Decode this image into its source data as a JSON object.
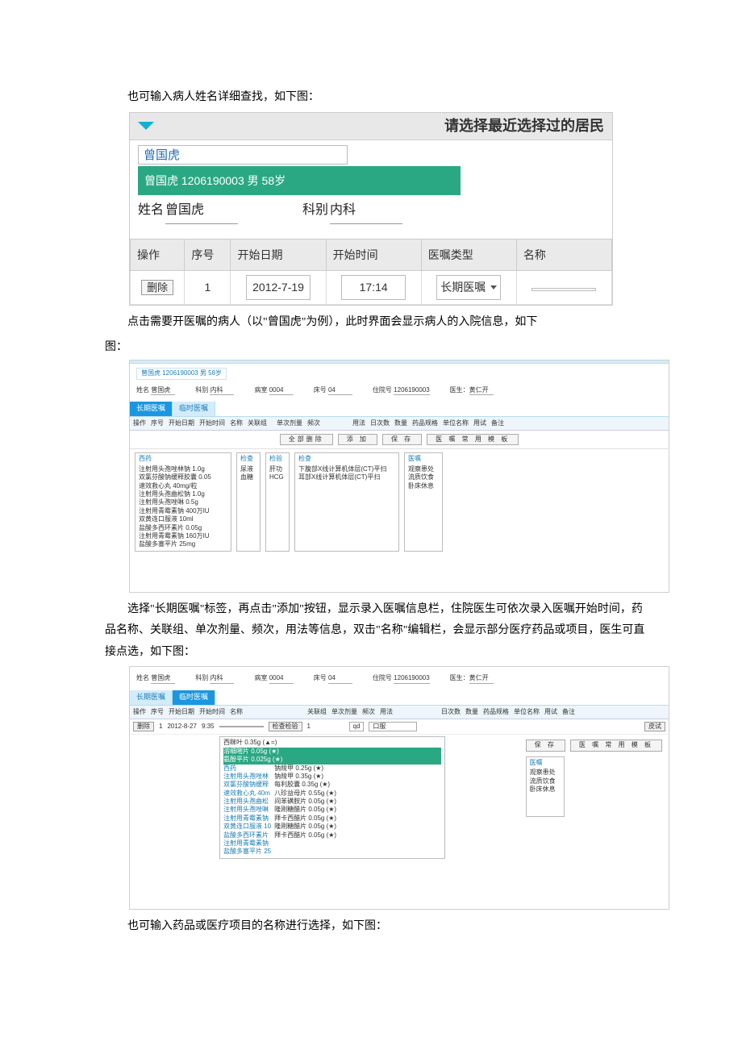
{
  "text": {
    "para1": "也可输入病人姓名详细查找，如下图：",
    "para2a": "点击需要开医嘱的病人（以\"曾国虎\"为例），此时界面会显示病人的入院信息，如下",
    "para2b": "图：",
    "para3": "选择\"长期医嘱\"标签，再点击\"添加\"按钮，显示录入医嘱信息栏，住院医生可依次录入医嘱开始时间，药品名称、关联组、单次剂量、频次，用法等信息，双击\"名称\"编辑栏，会显示部分医疗药品或项目，医生可直接点选，如下图：",
    "para4": "也可输入药品或医疗项目的名称进行选择，如下图："
  },
  "s1": {
    "caption": "请选择最近选择过的居民",
    "search_value": "曾国虎",
    "dropdown_hit": "曾国虎 1206190003 男 58岁",
    "name_label": "姓名",
    "name_value": "曾国虎",
    "dept_label": "科别",
    "dept_value": "内科",
    "columns": [
      "操作",
      "序号",
      "开始日期",
      "开始时间",
      "医嘱类型",
      "名称"
    ],
    "row": {
      "delete": "删除",
      "seq": "1",
      "date": "2012-7-19",
      "time": "17:14",
      "type": "长期医嘱",
      "name": ""
    }
  },
  "s2": {
    "patient_box": "曾国虎 1206190003 男 58岁",
    "meta": {
      "name_label": "姓名",
      "name": "曾国虎",
      "dept_label": "科别",
      "dept": "内科",
      "ward_label": "病室",
      "ward": "0004",
      "bed_label": "床号",
      "bed": "04",
      "hosp_label": "住院号",
      "hosp": "1206190003",
      "doctor_label": "医生：",
      "doctor": "黄仁开"
    },
    "tabs": [
      "长期医嘱",
      "临时医嘱"
    ],
    "columns": [
      "操作",
      "序号",
      "开始日期",
      "开始时间",
      "名称",
      "关联组",
      "单次剂量",
      "频次",
      "用法",
      "日次数",
      "数量",
      "药品规格",
      "单位名称",
      "用试",
      "备注"
    ],
    "buttons": {
      "delete_all": "全部删除",
      "add": "添 加",
      "save": "保 存",
      "template": "医 嘱 常 用 模 板"
    },
    "panels": {
      "drugs": {
        "title": "西药",
        "items": [
          "注射用头孢唑林钠 1.0g",
          "双氯芬酸钠缓释胶囊 0.05",
          "速效救心丸 40mg/粒",
          "注射用头孢曲松钠 1.0g",
          "注射用头孢唑啉 0.5g",
          "注射用青霉素钠 400万IU",
          "双黄连口服液 10ml",
          "盐酸多西环素片 0.05g",
          "注射用青霉素钠 160万IU",
          "盐酸多塞平片 25mg"
        ]
      },
      "test1": {
        "title": "检查",
        "items": [
          "尿液",
          "血糖"
        ]
      },
      "test2": {
        "title": "检验",
        "items": [
          "肝功",
          "HCG"
        ]
      },
      "exam": {
        "title": "检查",
        "items": [
          "下腹部X线计算机体层(CT)平扫",
          "耳部X线计算机体层(CT)平扫"
        ]
      },
      "order": {
        "title": "医嘱",
        "items": [
          "观察患处",
          "流质饮食",
          "卧床休息"
        ]
      }
    }
  },
  "s3": {
    "tabs_active": 1,
    "row": {
      "delete": "删除",
      "seq": "1",
      "date": "2012-8-27",
      "time": "9:35",
      "name_placeholder": "检查检验",
      "assoc": "1",
      "freq": "qd",
      "usage": "口服",
      "memo_btn": "皮试"
    },
    "suggestions_head": "西眯叶 0.35g (▲=)",
    "suggestions_hl1": "溶细嘧片 0.05g (★)",
    "suggestions_hl2": "氨酚平片 0.025g (★)",
    "drug_list_left": [
      "西药",
      "注射用头孢唑林",
      "双氯芬酸钠缓释",
      "速效救心丸 40m",
      "注射用头孢曲松",
      "注射用头孢唑啉",
      "注射用青霉素钠",
      "双黄连口服液 10",
      "盐酸多西环素片",
      "注射用青霉素钠",
      "盐酸多塞平片 25"
    ],
    "drug_list_right": [
      "钠羧甲 0.25g (★)",
      "钠羧甲 0.35g (★)",
      "每利胶囊 0.35g (★)",
      "八珍益母片 0.55g (★)",
      "间苯磺胺片 0.05g (★)",
      "隆刚糖醋片 0.05g (★)",
      "拜卡西醋片 0.05g (★)",
      "隆刚糖醋片 0.05g (★)",
      "拜卡西醋片 0.05g (★)"
    ],
    "side_panel": {
      "title": "医嘱",
      "items": [
        "观察患处",
        "流质饮食",
        "卧床休息"
      ]
    },
    "buttons": {
      "save": "保 存",
      "template": "医 嘱 常 用 模 板"
    },
    "columns": [
      "操作",
      "序号",
      "开始日期",
      "开始时间",
      "名称",
      "关联组",
      "单次剂量",
      "频次",
      "用法",
      "日次数",
      "数量",
      "药品规格",
      "单位名称",
      "用试",
      "备注"
    ]
  }
}
